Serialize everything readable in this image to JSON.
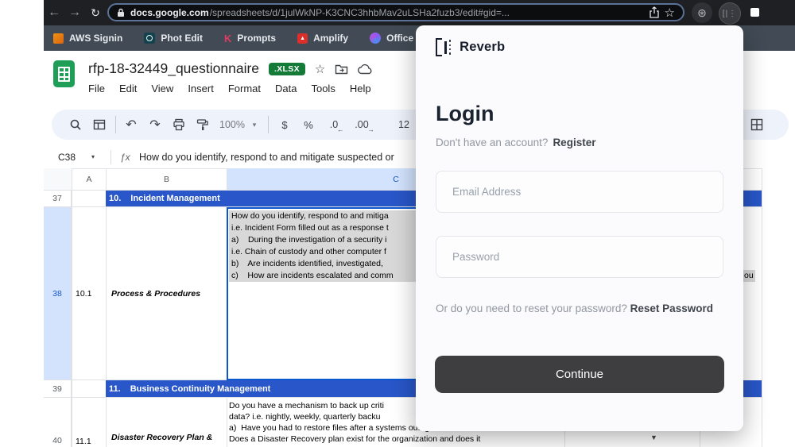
{
  "chrome": {
    "url_host": "docs.google.com",
    "url_path": "/spreadsheets/d/1julWkNP-K3CNC3hhbMav2uLSHa2fuzb3/edit#gid=...",
    "bookmarks": [
      {
        "label": "AWS Signin"
      },
      {
        "label": "Phot Edit"
      },
      {
        "label": "Prompts"
      },
      {
        "label": "Amplify"
      },
      {
        "label": "Office"
      }
    ]
  },
  "icons": {
    "back": "←",
    "forward": "→",
    "reload": "↻",
    "url_star": "☆",
    "gear": "⊛",
    "ext_logo": "[|⋮",
    "title_star": "☆",
    "caret": "▾",
    "undo": "↶",
    "redo": "↷",
    "dec_arrow": "←",
    "inc_arrow": "→",
    "dropdown": "▼",
    "amplify_mark": "▲",
    "prompts_mark": "K"
  },
  "doc": {
    "title": "rfp-18-32449_questionnaire",
    "badge": ".XLSX",
    "menus": [
      "File",
      "Edit",
      "View",
      "Insert",
      "Format",
      "Data",
      "Tools",
      "Help"
    ],
    "toolbar": {
      "zoom": "100%",
      "currency": "$",
      "percent": "%",
      "dec_dec": ".0",
      "dec_inc": ".00",
      "font_size": "12"
    },
    "name_box": "C38",
    "fx": "ƒx",
    "formula": "How do you identify, respond to and mitigate suspected or"
  },
  "grid": {
    "col_headers": [
      "A",
      "B",
      "C"
    ],
    "row37": {
      "num": "37",
      "section": "10.",
      "title": "Incident Management"
    },
    "row38": {
      "num": "38",
      "a": "10.1",
      "b": "Process & Procedures",
      "c1": "How do you identify, respond to and mitiga",
      "c2": "i.e. Incident Form filled out as a response t",
      "c3": "a)    During the investigation of a security i",
      "c4": "i.e. Chain of custody and other computer f",
      "c5": "b)    Are incidents identified, investigated,",
      "c6": "c)    How are incidents escalated and comm",
      "e_fragment": "ou"
    },
    "row39": {
      "num": "39",
      "section": "11.",
      "title": "Business Continuity Management"
    },
    "row40": {
      "num": "40",
      "a": "11.1",
      "b": "Disaster Recovery Plan &",
      "c1": "Do you have a mechanism to back up criti",
      "c2": "data? i.e. nightly, weekly, quarterly backu",
      "c3": "a)  Have you had to restore files after a systems outage?",
      "c4": "Does a Disaster Recovery plan exist for the organization and does it"
    }
  },
  "modal": {
    "brand": "Reverb",
    "heading": "Login",
    "register_prompt": "Don't have an account?",
    "register_link": "Register",
    "email_placeholder": "Email Address",
    "password_placeholder": "Password",
    "reset_prompt": "Or do you need to reset your password?",
    "reset_link": "Reset Password",
    "continue_label": "Continue"
  },
  "colors": {
    "banner_blue": "#2956c8",
    "selection_blue": "#0b57d0",
    "badge_green": "#147b39",
    "continue_dark": "#3e3e41"
  }
}
